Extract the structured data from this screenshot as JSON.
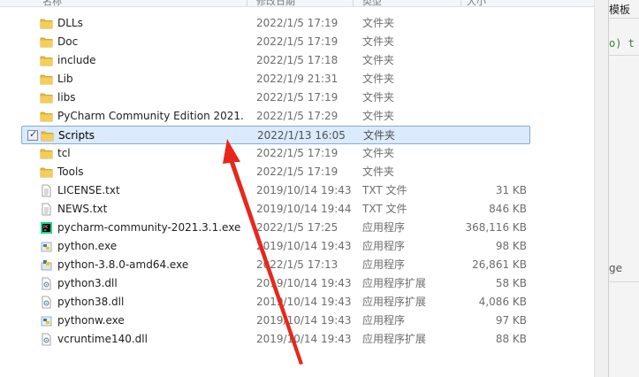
{
  "header": {
    "columns": [
      "名称",
      "修改日期",
      "类型",
      "大小"
    ]
  },
  "files": [
    {
      "name": "DLLs",
      "date": "2022/1/5 17:19",
      "type": "文件夹",
      "size": "",
      "icon": "folder-icon"
    },
    {
      "name": "Doc",
      "date": "2022/1/5 17:19",
      "type": "文件夹",
      "size": "",
      "icon": "folder-icon"
    },
    {
      "name": "include",
      "date": "2022/1/5 17:18",
      "type": "文件夹",
      "size": "",
      "icon": "folder-icon"
    },
    {
      "name": "Lib",
      "date": "2022/1/9 21:31",
      "type": "文件夹",
      "size": "",
      "icon": "folder-icon"
    },
    {
      "name": "libs",
      "date": "2022/1/5 17:19",
      "type": "文件夹",
      "size": "",
      "icon": "folder-icon"
    },
    {
      "name": "PyCharm Community Edition 2021....",
      "date": "2022/1/5 17:29",
      "type": "文件夹",
      "size": "",
      "icon": "folder-icon"
    },
    {
      "name": "Scripts",
      "date": "2022/1/13 16:05",
      "type": "文件夹",
      "size": "",
      "icon": "folder-icon",
      "selected": true
    },
    {
      "name": "tcl",
      "date": "2022/1/5 17:19",
      "type": "文件夹",
      "size": "",
      "icon": "folder-icon"
    },
    {
      "name": "Tools",
      "date": "2022/1/5 17:19",
      "type": "文件夹",
      "size": "",
      "icon": "folder-icon"
    },
    {
      "name": "LICENSE.txt",
      "date": "2019/10/14 19:43",
      "type": "TXT 文件",
      "size": "31 KB",
      "icon": "text-file-icon"
    },
    {
      "name": "NEWS.txt",
      "date": "2019/10/14 19:44",
      "type": "TXT 文件",
      "size": "846 KB",
      "icon": "text-file-icon"
    },
    {
      "name": "pycharm-community-2021.3.1.exe",
      "date": "2022/1/5 17:25",
      "type": "应用程序",
      "size": "368,116 KB",
      "icon": "pycharm-icon"
    },
    {
      "name": "python.exe",
      "date": "2019/10/14 19:43",
      "type": "应用程序",
      "size": "98 KB",
      "icon": "python-icon"
    },
    {
      "name": "python-3.8.0-amd64.exe",
      "date": "2022/1/5 17:13",
      "type": "应用程序",
      "size": "26,861 KB",
      "icon": "installer-icon"
    },
    {
      "name": "python3.dll",
      "date": "2019/10/14 19:43",
      "type": "应用程序扩展",
      "size": "58 KB",
      "icon": "dll-icon"
    },
    {
      "name": "python38.dll",
      "date": "2019/10/14 19:43",
      "type": "应用程序扩展",
      "size": "4,086 KB",
      "icon": "dll-icon"
    },
    {
      "name": "pythonw.exe",
      "date": "2019/10/14 19:43",
      "type": "应用程序",
      "size": "97 KB",
      "icon": "python-icon"
    },
    {
      "name": "vcruntime140.dll",
      "date": "2019/10/14 19:43",
      "type": "应用程序扩展",
      "size": "88 KB",
      "icon": "dll-icon"
    }
  ],
  "right_panel": {
    "line1": "模板",
    "line2": "o) t",
    "line3": "ge"
  },
  "colors": {
    "selection_bg": "#dbeafc",
    "selection_border": "#84acdd",
    "folder": "#e8b83a",
    "arrow": "#e8271c"
  }
}
